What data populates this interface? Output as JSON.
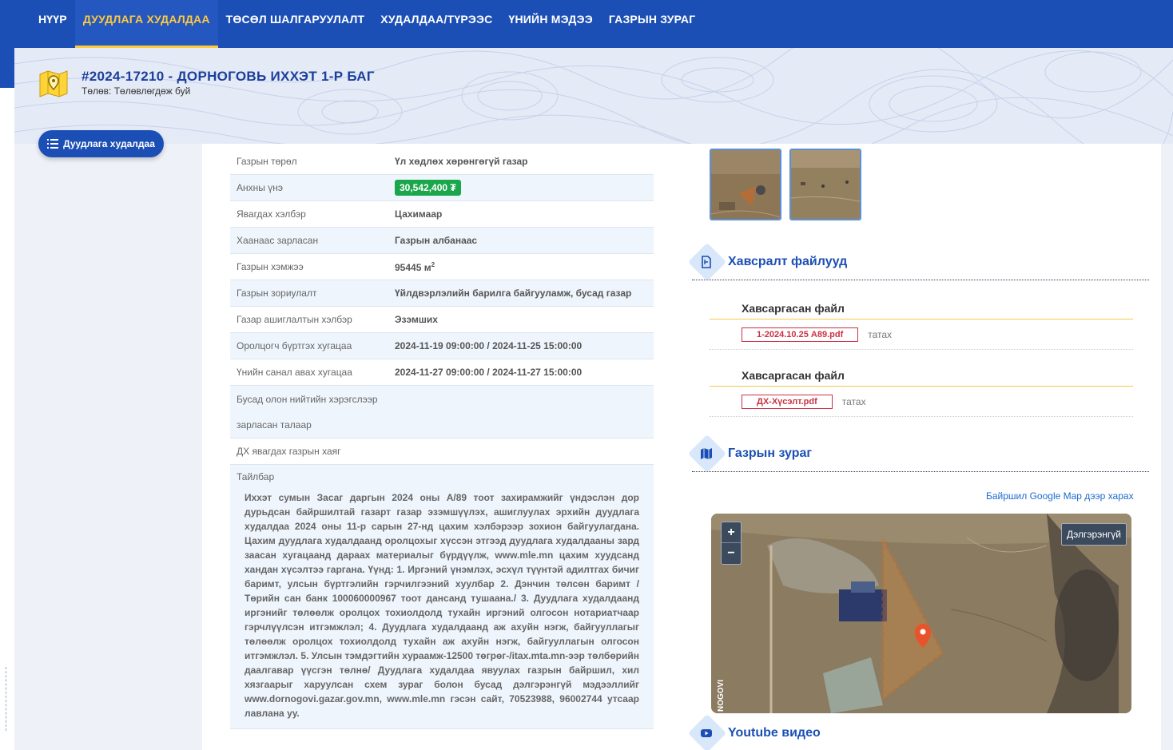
{
  "nav": {
    "items": [
      {
        "label": "НҮҮР",
        "active": false
      },
      {
        "label": "ДУУДЛАГА ХУДАЛДАА",
        "active": true
      },
      {
        "label": "ТӨСӨЛ ШАЛГАРУУЛАЛТ",
        "active": false
      },
      {
        "label": "ХУДАЛДАА/ТҮРЭЭС",
        "active": false
      },
      {
        "label": "ҮНИЙН МЭДЭЭ",
        "active": false
      },
      {
        "label": "ГАЗРЫН ЗУРАГ",
        "active": false
      }
    ]
  },
  "hero": {
    "title": "#2024-17210 - ДОРНОГОВЬ ИХХЭТ 1-Р БАГ",
    "status": "Төлөв: Төлөвлөгдөж буй"
  },
  "menu_button": {
    "label": "Дуудлага худалдаа"
  },
  "info": {
    "rows": [
      {
        "key": "Газрын төрөл",
        "value": "Үл хөдлөх хөрөнгөгүй газар"
      },
      {
        "key": "Анхны үнэ",
        "value": "30,542,400 ₮"
      },
      {
        "key": "Явагдах хэлбэр",
        "value": "Цахимаар"
      },
      {
        "key": "Хаанаас зарласан",
        "value": "Газрын албанаас"
      },
      {
        "key": "Газрын хэмжээ",
        "value": "95445 м",
        "sup": "2"
      },
      {
        "key": "Газрын зориулалт",
        "value": "Үйлдвэрлэлийн барилга байгууламж, бусад газар"
      },
      {
        "key": "Газар ашиглалтын хэлбэр",
        "value": "Эзэмших"
      },
      {
        "key": "Оролцогч бүртгэх хугацаа",
        "value": "2024-11-19 09:00:00 / 2024-11-25 15:00:00"
      },
      {
        "key": "Үнийн санал авах хугацаа",
        "value": "2024-11-27 09:00:00 / 2024-11-27 15:00:00"
      }
    ],
    "public_announce_key_1": "Бусад олон нийтийн хэрэгслээр",
    "public_announce_key_2": "зарласан талаар",
    "address_key": "ДХ явагдах газрын хаяг",
    "description_key": "Тайлбар",
    "description": "Иххэт сумын Засаг даргын 2024 оны А/89 тоот захирамжийг үндэслэн дор дурьдсан байршилтай газарт газар эзэмшүүлэх, ашиглуулах эрхийн дуудлага худалдаа 2024 оны 11-р сарын 27-нд цахим хэлбэрээр зохион байгуулагдана. Цахим дуудлага худалдаанд оролцохыг хүссэн этгээд дуудлага худалдааны зард заасан хугацаанд дараах материалыг бүрдүүлж, www.mle.mn цахим хуудсанд хандан хүсэлтээ гаргана. Үүнд: 1. Иргэний үнэмлэх, эсхүл түүнтэй адилтгах бичиг баримт, улсын бүртгэлийн гэрчилгээний хуулбар 2. Дэнчин төлсөн баримт /Төрийн сан банк 100060000967 тоот дансанд тушаана./ 3. Дуудлага худалдаанд иргэнийг төлөөлж оролцох тохиолдолд тухайн иргэний олгосон нотариатчаар гэрчлүүлсэн итгэмжлэл; 4. Дуудлага худалдаанд аж ахуйн нэгж, байгууллагыг төлөөлж оролцох тохиолдолд тухайн аж ахуйн нэгж, байгууллагын олгосон итгэмжлэл. 5. Улсын тэмдэгтийн хураамж-12500 төгрөг-/itax.mta.mn-ээр төлбөрийн даалгавар үүсгэн төлнө/ Дуудлага худалдаа явуулах газрын байршил, хил хязгаарыг харуулсан схем зураг болон бусад дэлгэрэнгүй мэдээллийг www.dornogovi.gazar.gov.mn, www.mle.mn гэсэн сайт, 70523988, 96002744 утсаар лавлана уу."
  },
  "attachments": {
    "title": "Хавсралт файлууд",
    "files": [
      {
        "heading": "Хавсаргасан файл",
        "name": "1-2024.10.25 А89.pdf",
        "download": "татах"
      },
      {
        "heading": "Хавсаргасан файл",
        "name": "ДХ-Хүсэлт.pdf",
        "download": "татах"
      }
    ]
  },
  "map_section": {
    "title": "Газрын зураг",
    "google_link": "Байршил Google Map дээр харах",
    "zoom_in": "+",
    "zoom_out": "−",
    "detail_button": "Дэлгэрэнгүй",
    "map_label": "NOGOVI"
  },
  "youtube": {
    "title": "Youtube видео"
  },
  "colors": {
    "primary": "#1c4fb5",
    "accent": "#ffc93c",
    "price": "#1aa64a",
    "file": "#c93144"
  }
}
